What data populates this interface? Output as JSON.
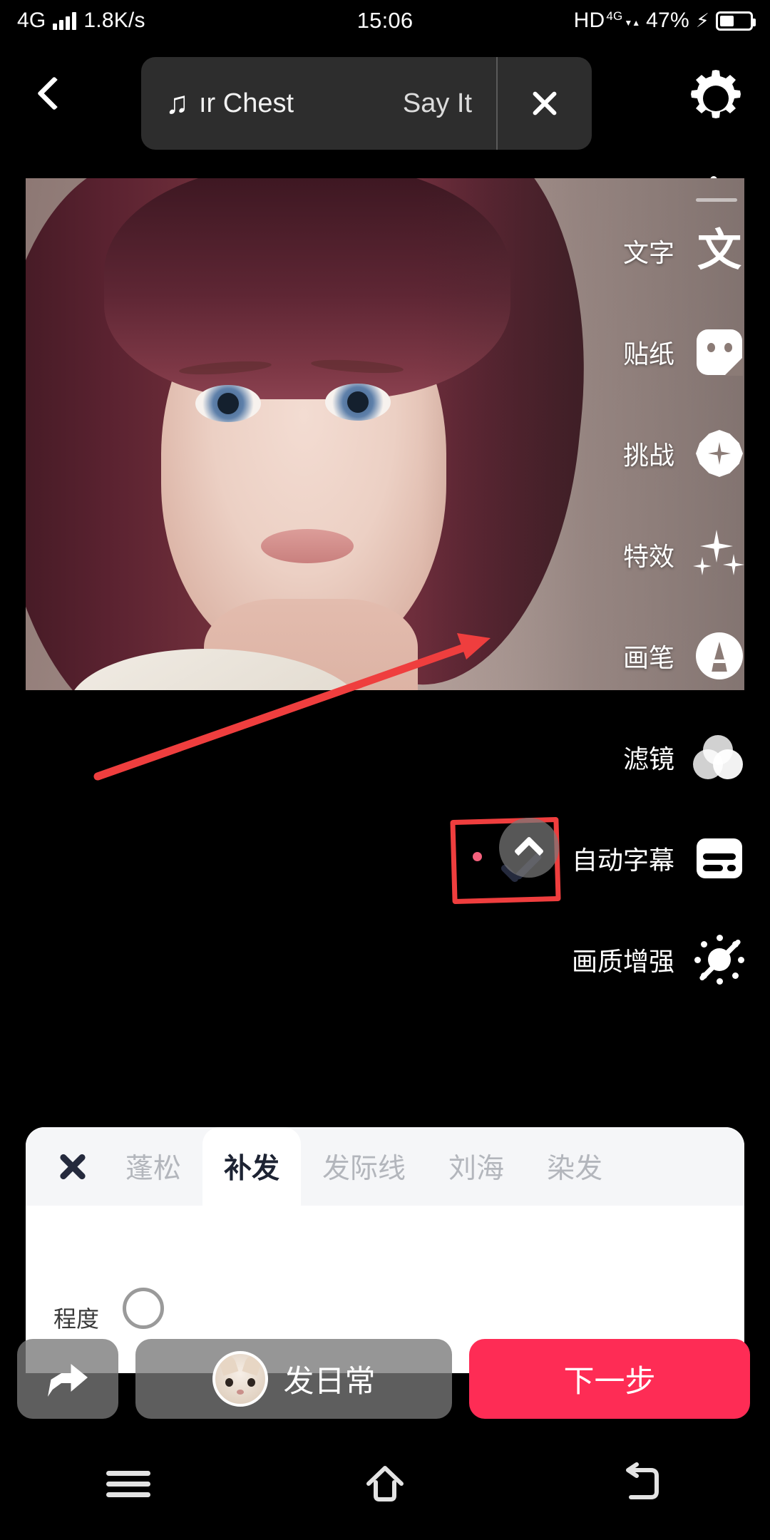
{
  "status_bar": {
    "network_type": "4G",
    "speed": "1.8K/s",
    "time": "15:06",
    "hd": "HD",
    "hd_sup": "4G",
    "hd_arrows": "▼▲",
    "battery_percent": "47%",
    "charging_icon": "bolt-icon"
  },
  "top_bar": {
    "back_icon": "chevron-left-icon",
    "music": {
      "note_icon": "music-note-icon",
      "title": "ır Chest",
      "subtitle": "Say It",
      "close_icon": "close-icon"
    },
    "settings_icon": "gear-icon",
    "download_icon": "download-icon"
  },
  "tool_rail": {
    "items": [
      {
        "label": "文字",
        "icon": "text-icon"
      },
      {
        "label": "贴纸",
        "icon": "sticker-icon"
      },
      {
        "label": "挑战",
        "icon": "challenge-icon"
      },
      {
        "label": "特效",
        "icon": "effects-sparkle-icon"
      },
      {
        "label": "画笔",
        "icon": "brush-icon"
      },
      {
        "label": "滤镜",
        "icon": "filter-circles-icon"
      },
      {
        "label": "自动字幕",
        "icon": "auto-caption-icon"
      },
      {
        "label": "画质增强",
        "icon": "quality-enhance-off-icon"
      }
    ]
  },
  "annotations": {
    "arrow_color": "#ef3e3e",
    "box_color": "#ef3e3e",
    "arrow_points_to": "滤镜"
  },
  "bottom_sheet": {
    "close_icon": "close-icon",
    "tabs": [
      {
        "label": "蓬松",
        "active": false
      },
      {
        "label": "补发",
        "active": true
      },
      {
        "label": "发际线",
        "active": false
      },
      {
        "label": "刘海",
        "active": false
      },
      {
        "label": "染发",
        "active": false
      }
    ],
    "confirm_icon": "check-icon",
    "collapse_icon": "chevron-up-icon",
    "badge_dot_color": "#f5617d"
  },
  "slider": {
    "label": "程度",
    "knob_icon": "slider-knob-icon"
  },
  "action_bar": {
    "share_icon": "share-arrow-icon",
    "daily_label": "发日常",
    "avatar_icon": "cat-avatar-icon",
    "next_label": "下一步",
    "next_color": "#fe2c55"
  },
  "nav_bar": {
    "menu_icon": "menu-icon",
    "home_icon": "home-icon",
    "back_icon": "back-icon"
  }
}
